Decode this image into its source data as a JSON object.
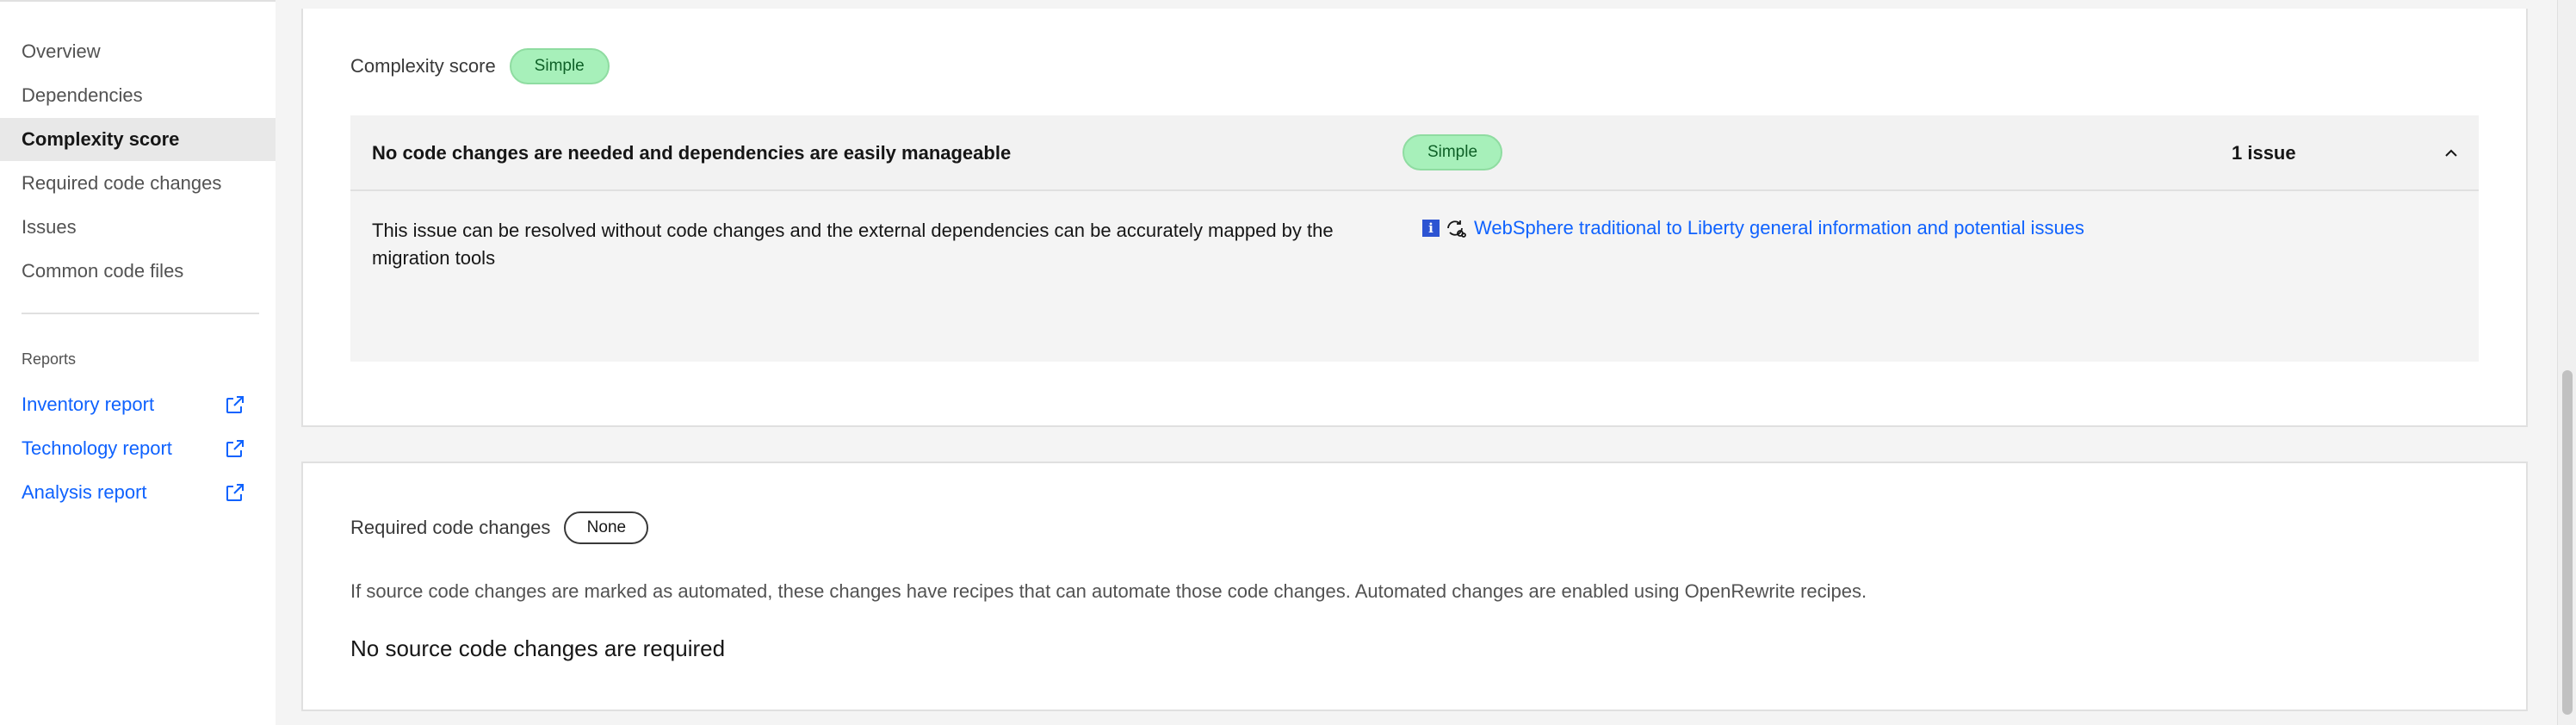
{
  "sidebar": {
    "items": [
      {
        "label": "Overview"
      },
      {
        "label": "Dependencies"
      },
      {
        "label": "Complexity score",
        "active": true
      },
      {
        "label": "Required code changes"
      },
      {
        "label": "Issues"
      },
      {
        "label": "Common code files"
      }
    ],
    "reports_heading": "Reports",
    "reports": [
      {
        "label": "Inventory report",
        "icon": "external-link-icon"
      },
      {
        "label": "Technology report",
        "icon": "external-link-icon"
      },
      {
        "label": "Analysis report",
        "icon": "external-link-icon"
      }
    ]
  },
  "complexity": {
    "title": "Complexity score",
    "tag": "Simple",
    "row": {
      "title": "No code changes are needed and dependencies are easily manageable",
      "tag": "Simple",
      "count": "1 issue",
      "description_line1": "This issue can be resolved without code changes and the external dependencies can be accurately mapped by the",
      "description_line2": "migration tools",
      "info_icon_text": "i",
      "link_label": "WebSphere traditional to Liberty general information and potential issues"
    }
  },
  "code_changes": {
    "title": "Required code changes",
    "tag": "None",
    "info": "If source code changes are marked as automated, these changes have recipes that can automate those code changes. Automated changes are enabled using OpenRewrite recipes.",
    "empty_message": "No source code changes are required"
  },
  "colors": {
    "accent": "#0f62fe",
    "tag_green_bg": "#a7f0ba",
    "tag_green_text": "#0e6027"
  }
}
